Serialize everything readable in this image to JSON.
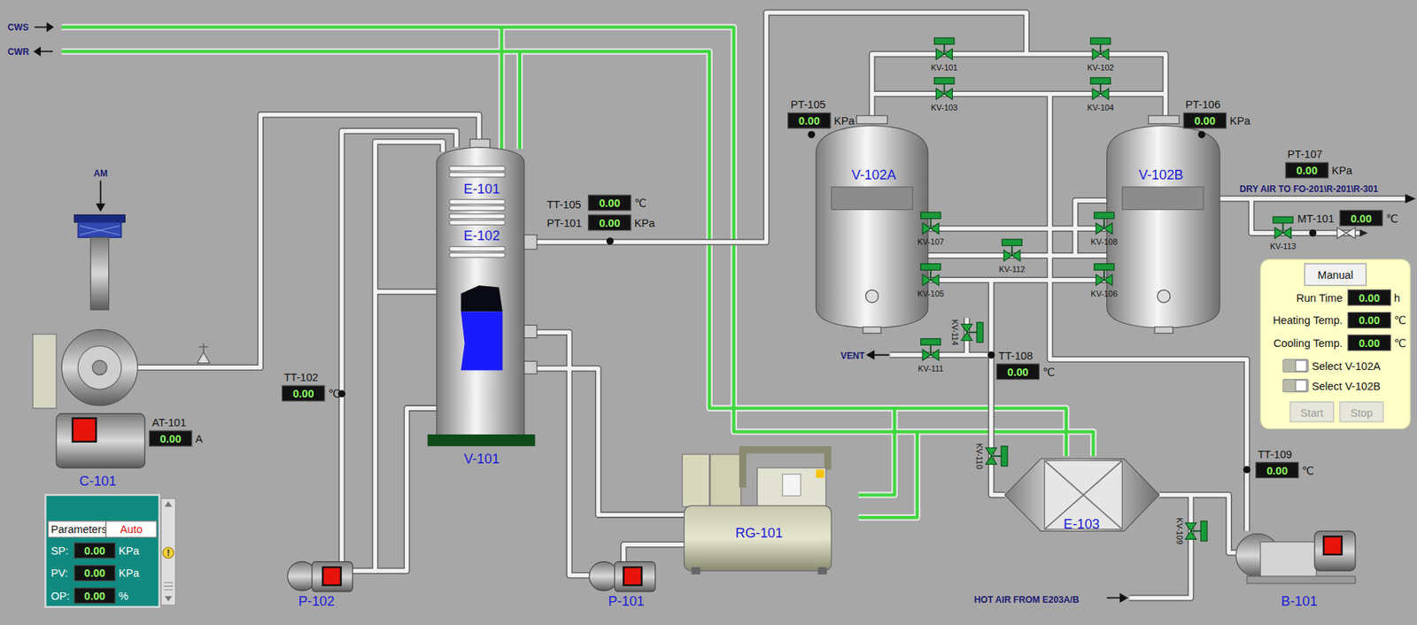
{
  "streams": [
    {
      "label": "CWS"
    },
    {
      "label": "CWR"
    },
    {
      "label": "AM"
    },
    {
      "label": "VENT"
    },
    {
      "label": "DRY AIR TO FO-201\\R-201\\R-301"
    },
    {
      "label": "HOT AIR FROM E203A/B"
    }
  ],
  "equipment": [
    {
      "tag": "C-101"
    },
    {
      "tag": "V-101"
    },
    {
      "tag": "E-101"
    },
    {
      "tag": "E-102"
    },
    {
      "tag": "P-102"
    },
    {
      "tag": "P-101"
    },
    {
      "tag": "RG-101"
    },
    {
      "tag": "V-102A"
    },
    {
      "tag": "V-102B"
    },
    {
      "tag": "E-103"
    },
    {
      "tag": "B-101"
    }
  ],
  "instruments": [
    {
      "tag": "AT-101",
      "value": "0.00",
      "unit": "A"
    },
    {
      "tag": "TT-102",
      "value": "0.00",
      "unit": "℃"
    },
    {
      "tag": "TT-105",
      "value": "0.00",
      "unit": "℃"
    },
    {
      "tag": "PT-101",
      "value": "0.00",
      "unit": "KPa"
    },
    {
      "tag": "PT-105",
      "value": "0.00",
      "unit": "KPa"
    },
    {
      "tag": "PT-106",
      "value": "0.00",
      "unit": "KPa"
    },
    {
      "tag": "PT-107",
      "value": "0.00",
      "unit": "KPa"
    },
    {
      "tag": "MT-101",
      "value": "0.00",
      "unit": "℃"
    },
    {
      "tag": "TT-108",
      "value": "0.00",
      "unit": "℃"
    },
    {
      "tag": "TT-109",
      "value": "0.00",
      "unit": "℃"
    }
  ],
  "valves": [
    {
      "tag": "KV-101"
    },
    {
      "tag": "KV-102"
    },
    {
      "tag": "KV-103"
    },
    {
      "tag": "KV-104"
    },
    {
      "tag": "KV-105"
    },
    {
      "tag": "KV-106"
    },
    {
      "tag": "KV-107"
    },
    {
      "tag": "KV-108"
    },
    {
      "tag": "KV-109"
    },
    {
      "tag": "KV-110"
    },
    {
      "tag": "KV-111"
    },
    {
      "tag": "KV-112"
    },
    {
      "tag": "KV-113"
    },
    {
      "tag": "KV-114"
    }
  ],
  "control_panel": {
    "mode": "Manual",
    "fields": [
      {
        "label": "Run Time",
        "value": "0.00",
        "unit": "h"
      },
      {
        "label": "Heating Temp.",
        "value": "0.00",
        "unit": "℃"
      },
      {
        "label": "Cooling Temp.",
        "value": "0.00",
        "unit": "℃"
      }
    ],
    "selects": [
      {
        "label": "Select V-102A",
        "checked": false
      },
      {
        "label": "Select V-102B",
        "checked": false
      }
    ],
    "buttons": [
      {
        "label": "Start",
        "disabled": true
      },
      {
        "label": "Stop",
        "disabled": true
      }
    ]
  },
  "controller": {
    "header": "Parameters",
    "mode": "Auto",
    "alarm_icon": "!",
    "rows": [
      {
        "label": "SP:",
        "value": "0.00",
        "unit": "KPa"
      },
      {
        "label": "PV:",
        "value": "0.00",
        "unit": "KPa"
      },
      {
        "label": "OP:",
        "value": "0.00",
        "unit": "%"
      }
    ]
  }
}
